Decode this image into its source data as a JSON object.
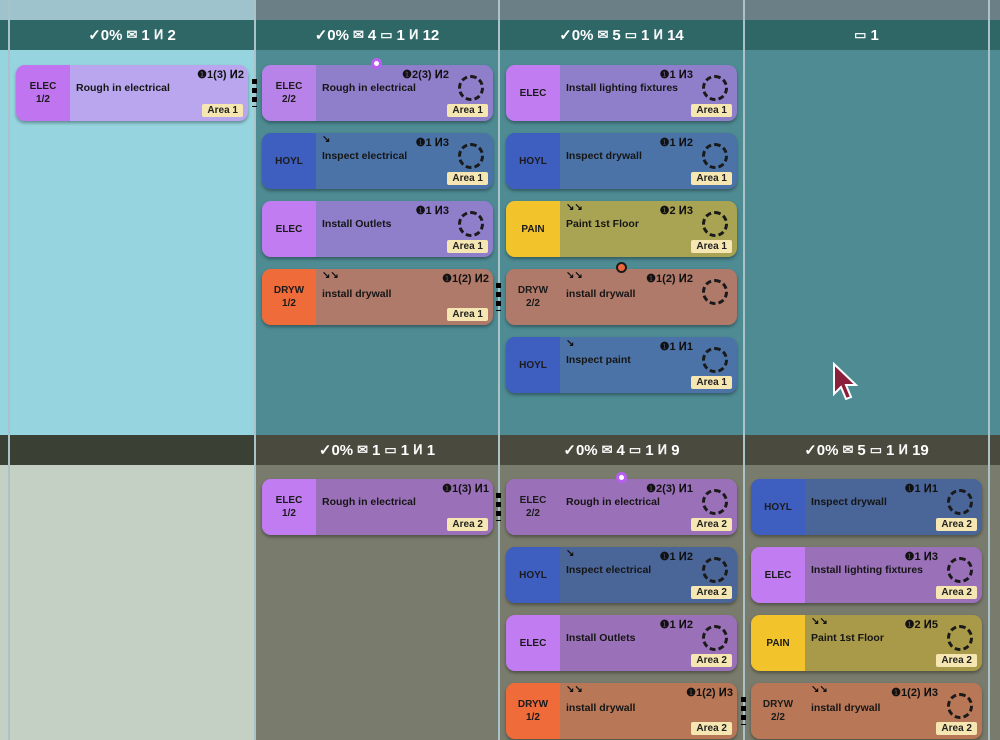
{
  "colors": {
    "elec": "#b57ae8",
    "hoyl": "#3e5fc0",
    "pain": "#f2c32a",
    "dryw": "#f06b3a"
  },
  "rows": [
    {
      "headers": [
        {
          "check": "✓0%",
          "items": [
            {
              "icon": "check-box-icon",
              "value": "1"
            },
            {
              "icon": "crew-icon",
              "value": "2"
            }
          ]
        },
        {
          "check": "✓0%",
          "items": [
            {
              "icon": "check-box-icon",
              "value": "4"
            },
            {
              "icon": "card-icon",
              "value": "1"
            },
            {
              "icon": "crew-icon",
              "value": "12"
            }
          ]
        },
        {
          "check": "✓0%",
          "items": [
            {
              "icon": "check-box-icon",
              "value": "5"
            },
            {
              "icon": "card-icon",
              "value": "1"
            },
            {
              "icon": "crew-icon",
              "value": "14"
            }
          ]
        },
        {
          "check": "",
          "items": [
            {
              "icon": "card-icon",
              "value": "1"
            }
          ]
        }
      ]
    },
    {
      "headers": [
        {
          "check": "",
          "items": []
        },
        {
          "check": "✓0%",
          "items": [
            {
              "icon": "check-box-icon",
              "value": "1"
            },
            {
              "icon": "card-icon",
              "value": "1"
            },
            {
              "icon": "crew-icon",
              "value": "1"
            }
          ]
        },
        {
          "check": "✓0%",
          "items": [
            {
              "icon": "check-box-icon",
              "value": "4"
            },
            {
              "icon": "card-icon",
              "value": "1"
            },
            {
              "icon": "crew-icon",
              "value": "9"
            }
          ]
        },
        {
          "check": "✓0%",
          "items": [
            {
              "icon": "check-box-icon",
              "value": "5"
            },
            {
              "icon": "card-icon",
              "value": "1"
            },
            {
              "icon": "crew-icon",
              "value": "19"
            }
          ]
        }
      ]
    }
  ],
  "cards": [
    {
      "trade": "ELEC\n1/2",
      "title": "Rough in electrical",
      "stats": "❶1(3) ⵍ2",
      "area": "Area 1",
      "dep": "",
      "ring": false
    },
    {
      "trade": "ELEC\n2/2",
      "title": "Rough in electrical",
      "stats": "❶2(3) ⵍ2",
      "area": "Area 1",
      "dep": "",
      "ring": true
    },
    {
      "trade": "ELEC",
      "title": "Install lighting fixtures",
      "stats": "❶1 ⵍ3",
      "area": "Area 1",
      "dep": "",
      "ring": true
    },
    {
      "trade": "HOYL",
      "title": "Inspect electrical",
      "stats": "❶1 ⵍ3",
      "area": "Area 1",
      "dep": "↘",
      "ring": true
    },
    {
      "trade": "HOYL",
      "title": "Inspect drywall",
      "stats": "❶1 ⵍ2",
      "area": "Area 1",
      "dep": "",
      "ring": true
    },
    {
      "trade": "ELEC",
      "title": "Install Outlets",
      "stats": "❶1 ⵍ3",
      "area": "Area 1",
      "dep": "",
      "ring": true
    },
    {
      "trade": "PAIN",
      "title": "Paint 1st Floor",
      "stats": "❶2 ⵍ3",
      "area": "Area 1",
      "dep": "↘↘",
      "ring": true
    },
    {
      "trade": "DRYW\n1/2",
      "title": "install drywall",
      "stats": "❶1(2) ⵍ2",
      "area": "Area 1",
      "dep": "↘↘",
      "ring": false
    },
    {
      "trade": "DRYW\n2/2",
      "title": "install drywall",
      "stats": "❶1(2) ⵍ2",
      "area": "Area 1",
      "dep": "↘↘",
      "ring": true
    },
    {
      "trade": "HOYL",
      "title": "Inspect paint",
      "stats": "❶1 ⵍ1",
      "area": "Area 1",
      "dep": "↘",
      "ring": true
    },
    {
      "trade": "ELEC\n1/2",
      "title": "Rough in electrical",
      "stats": "❶1(3) ⵍ1",
      "area": "Area 2",
      "dep": "",
      "ring": false
    },
    {
      "trade": "ELEC\n2/2",
      "title": "Rough in electrical",
      "stats": "❶2(3) ⵍ1",
      "area": "Area 2",
      "dep": "",
      "ring": true
    },
    {
      "trade": "HOYL",
      "title": "Inspect drywall",
      "stats": "❶1 ⵍ1",
      "area": "Area 2",
      "dep": "",
      "ring": true
    },
    {
      "trade": "HOYL",
      "title": "Inspect electrical",
      "stats": "❶1 ⵍ2",
      "area": "Area 2",
      "dep": "↘",
      "ring": true
    },
    {
      "trade": "ELEC",
      "title": "Install lighting fixtures",
      "stats": "❶1 ⵍ3",
      "area": "Area 2",
      "dep": "",
      "ring": true
    },
    {
      "trade": "ELEC",
      "title": "Install Outlets",
      "stats": "❶1 ⵍ2",
      "area": "Area 2",
      "dep": "",
      "ring": true
    },
    {
      "trade": "PAIN",
      "title": "Paint 1st Floor",
      "stats": "❶2 ⵍ5",
      "area": "Area 2",
      "dep": "↘↘",
      "ring": true
    },
    {
      "trade": "DRYW\n1/2",
      "title": "install drywall",
      "stats": "❶1(2) ⵍ3",
      "area": "Area 2",
      "dep": "↘↘",
      "ring": false
    },
    {
      "trade": "DRYW\n2/2",
      "title": "install drywall",
      "stats": "❶1(2) ⵍ3",
      "area": "Area 2",
      "dep": "↘↘",
      "ring": true
    }
  ]
}
